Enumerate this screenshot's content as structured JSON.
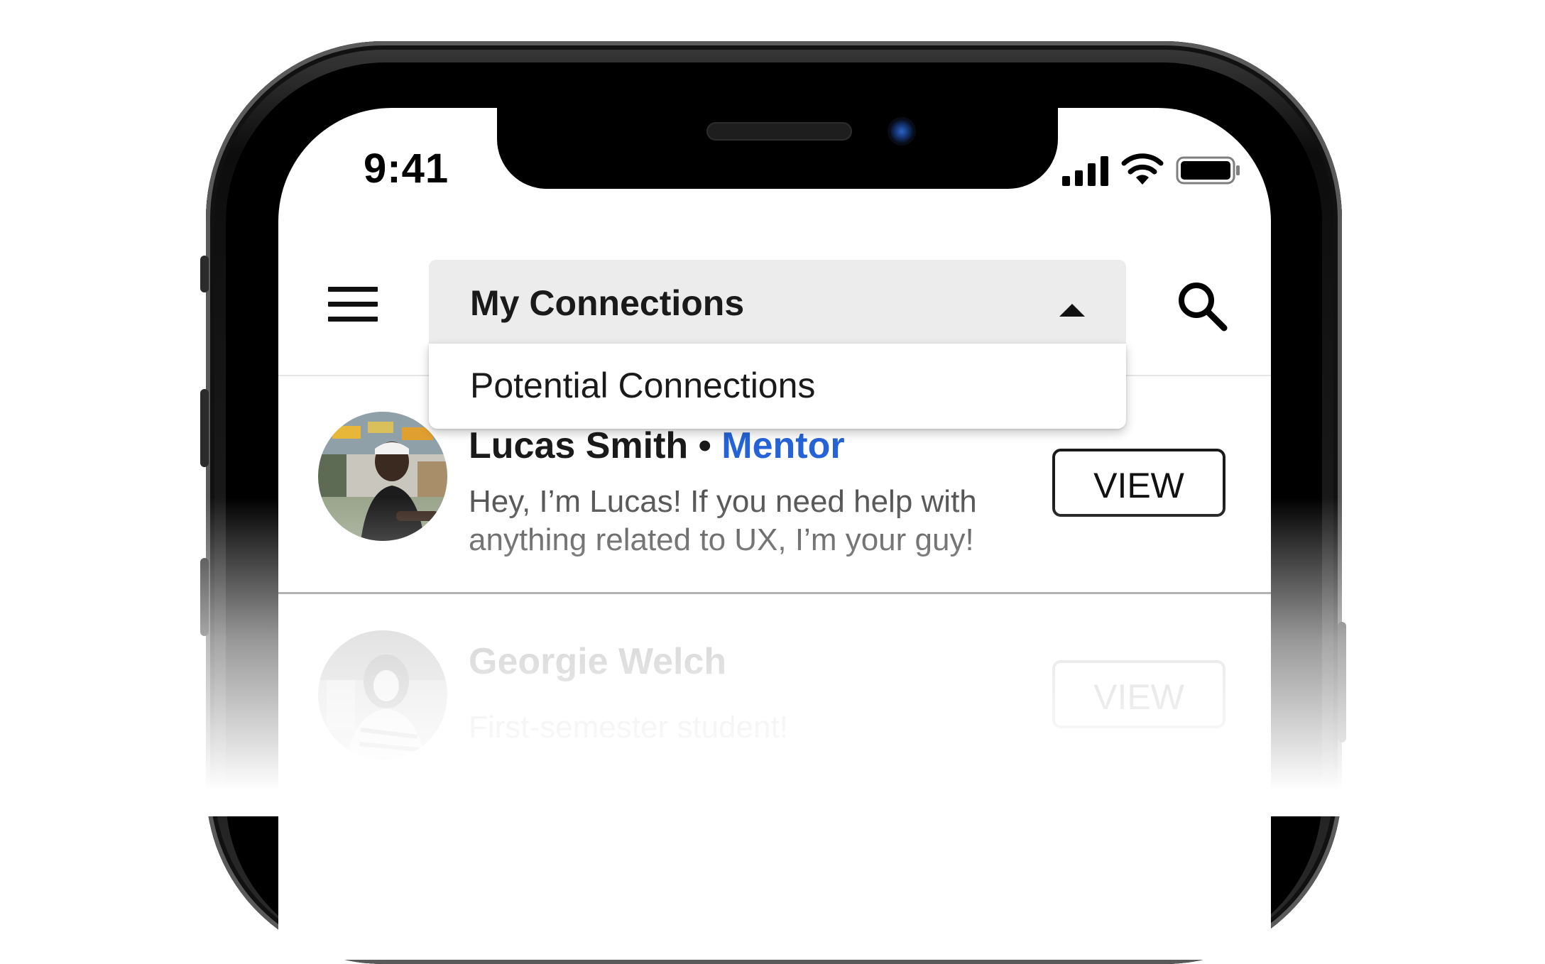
{
  "status_bar": {
    "time": "9:41"
  },
  "header": {
    "menu_icon": "menu-icon",
    "dropdown": {
      "selected": "My Connections",
      "expanded": true,
      "options": [
        "Potential Connections"
      ]
    },
    "search_icon": "search-icon"
  },
  "connections": [
    {
      "name": "Lucas Smith",
      "separator": " • ",
      "role": "Mentor",
      "bio": "Hey, I’m Lucas! If you need help with anything related to UX, I’m your guy!",
      "button_label": "VIEW"
    },
    {
      "name": "Georgie Welch",
      "bio": "First-semester student!",
      "button_label": "VIEW"
    }
  ],
  "colors": {
    "accent": "#2563d6",
    "dropdown_bg": "#ececec",
    "text_primary": "#1a1a1a",
    "text_secondary": "#555555"
  }
}
